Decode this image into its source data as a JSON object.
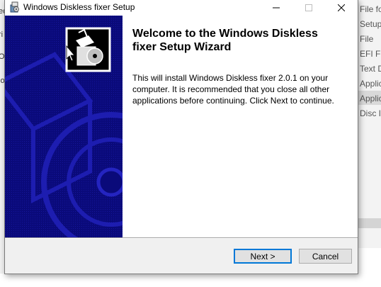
{
  "background_window": {
    "left_fragments": [
      "ed",
      "ri",
      "O",
      "lo"
    ],
    "right_items": [
      "File fo",
      "Setup",
      "File",
      "EFI Fil",
      "Text D",
      "Applic",
      "Applic",
      "Disc Im"
    ]
  },
  "dialog": {
    "title": "Windows Diskless fixer Setup",
    "welcome_title": "Welcome to the Windows Diskless fixer Setup Wizard",
    "welcome_body": "This will install Windows Diskless fixer 2.0.1 on your computer. It is recommended that you close all other applications before continuing. Click Next to continue.",
    "buttons": {
      "next": "Next >",
      "cancel": "Cancel"
    }
  },
  "colors": {
    "sidebar_blue": "#0a0a7a",
    "focus_border": "#0078d7"
  },
  "icons": [
    "installer-icon",
    "minimize-icon",
    "maximize-icon",
    "close-icon",
    "setup-box-icon",
    "cd-disc-icon",
    "mouse-cursor-icon"
  ]
}
